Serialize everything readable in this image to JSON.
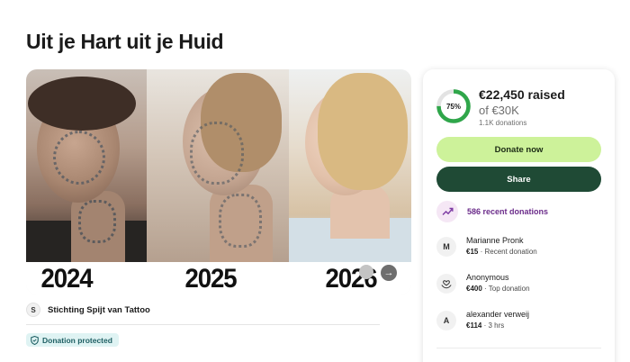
{
  "page": {
    "title": "Uit je Hart uit je Huid"
  },
  "hero": {
    "years": [
      "2024",
      "2025",
      "2026"
    ],
    "next_glyph": "→"
  },
  "organizer": {
    "avatar_initial": "S",
    "name": "Stichting Spijt van Tattoo"
  },
  "badge": {
    "label": "Donation protected",
    "icon": "shield-icon"
  },
  "progress": {
    "percent_label": "75%",
    "fraction": 0.75,
    "raised": "€22,450 raised",
    "goal": "of €30K",
    "donations": "1.1K donations",
    "ring_color": "#2fa64a"
  },
  "actions": {
    "donate_label": "Donate now",
    "share_label": "Share",
    "donate_color": "#cdf29a",
    "share_color": "#1f4a35"
  },
  "recent": {
    "label": "586 recent donations",
    "icon": "trending-up-icon"
  },
  "donors": [
    {
      "avatar": "M",
      "name": "Marianne Pronk",
      "amount": "€15",
      "note": " · Recent donation"
    },
    {
      "avatar": "heart-hands-icon",
      "name": "Anonymous",
      "amount": "€400",
      "note": " · Top donation"
    },
    {
      "avatar": "A",
      "name": "alexander verweij",
      "amount": "€114",
      "note": " · 3 hrs"
    }
  ]
}
